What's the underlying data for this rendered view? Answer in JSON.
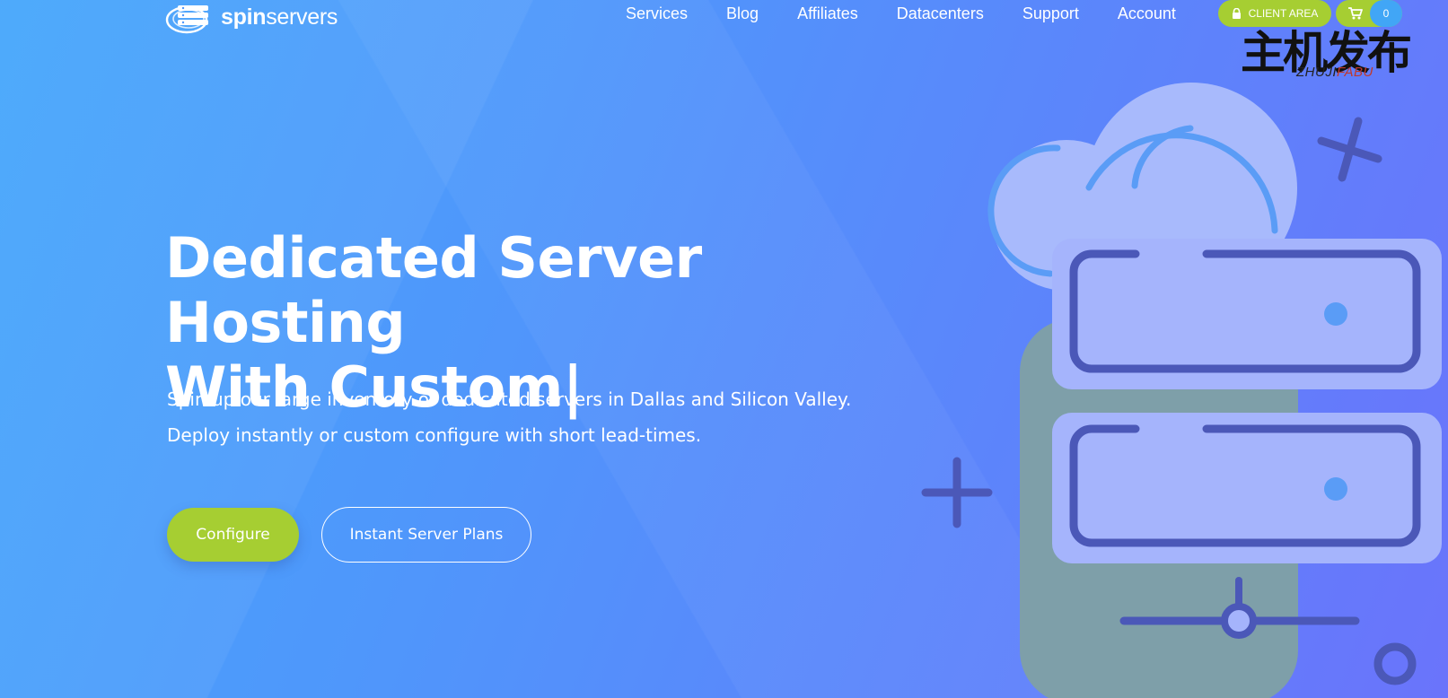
{
  "brand": {
    "name_bold": "spin",
    "name_rest": "servers"
  },
  "nav": {
    "items": [
      "Services",
      "Blog",
      "Affiliates",
      "Datacenters",
      "Support",
      "Account"
    ]
  },
  "header": {
    "client_area_label": "CLIENT AREA",
    "cart_count": "0"
  },
  "watermark": {
    "chinese": "主机发布",
    "latin_a": "ZHUJI",
    "latin_b": "FABU"
  },
  "hero": {
    "title_line1": "Dedicated Server Hosting",
    "title_line2": "With Custom|",
    "desc_line1": "Spin up our large inventory of dedicated servers in Dallas and Silicon Valley.",
    "desc_line2": "Deploy instantly or custom configure with short lead-times.",
    "configure_label": "Configure",
    "plans_label": "Instant Server Plans"
  },
  "colors": {
    "accent_green": "#a6ce32",
    "bg_start": "#45a6fb",
    "bg_end": "#6a74fb",
    "server_fill": "#a5b4fc",
    "server_stroke": "#4b58b8"
  },
  "icons": {
    "logo": "server-stack-icon",
    "client_area": "lock-icon",
    "cart": "shopping-cart-icon"
  }
}
